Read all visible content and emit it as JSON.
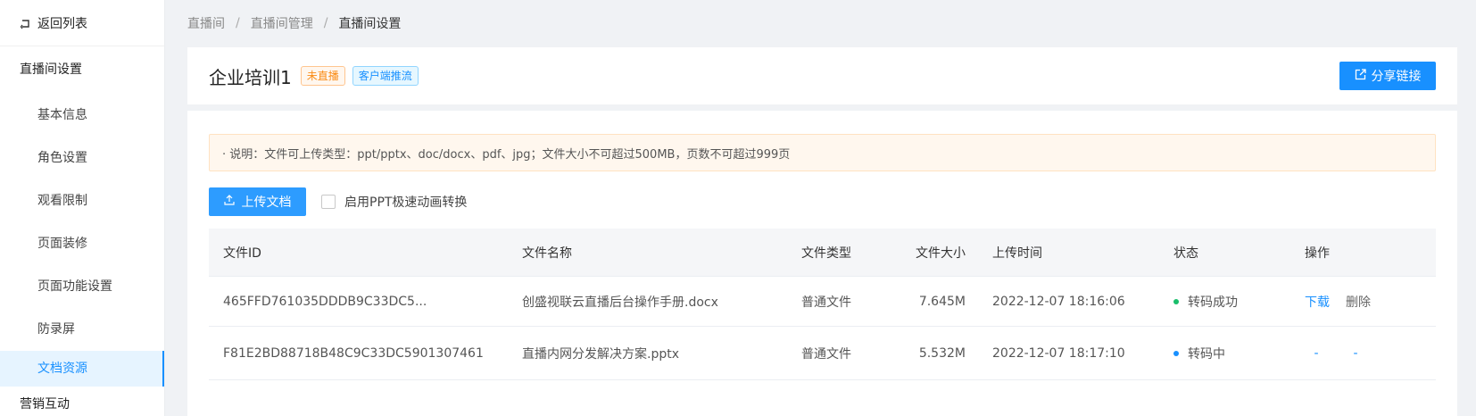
{
  "sidebar": {
    "back_label": "返回列表",
    "group1_title": "直播间设置",
    "items": [
      {
        "label": "基本信息"
      },
      {
        "label": "角色设置"
      },
      {
        "label": "观看限制"
      },
      {
        "label": "页面装修"
      },
      {
        "label": "页面功能设置"
      },
      {
        "label": "防录屏"
      },
      {
        "label": "文档资源",
        "active": true
      }
    ],
    "group2_title": "营销互动"
  },
  "breadcrumb": [
    "直播间",
    "直播间管理",
    "直播间设置"
  ],
  "header": {
    "title": "企业培训1",
    "tags": [
      "未直播",
      "客户端推流"
    ],
    "share_label": "分享链接"
  },
  "notice": "· 说明：文件可上传类型：ppt/pptx、doc/docx、pdf、jpg；文件大小不可超过500MB，页数不可超过999页",
  "upload_label": "上传文档",
  "checkbox_label": "启用PPT极速动画转换",
  "table": {
    "columns": [
      "文件ID",
      "文件名称",
      "文件类型",
      "文件大小",
      "上传时间",
      "状态",
      "操作"
    ],
    "rows": [
      {
        "id": "465FFD761035DDDB9C33DC5...",
        "name": "创盛视联云直播后台操作手册.docx",
        "type": "普通文件",
        "size": "7.645M",
        "time": "2022-12-07 18:16:06",
        "status": "转码成功",
        "status_color": "#19be6b",
        "actions": [
          "下载",
          "删除"
        ]
      },
      {
        "id": "F81E2BD88718B48C9C33DC5901307461",
        "name": "直播内网分发解决方案.pptx",
        "type": "普通文件",
        "size": "5.532M",
        "time": "2022-12-07 18:17:10",
        "status": "转码中",
        "status_color": "#1890ff",
        "actions": [
          "-",
          "-"
        ]
      }
    ]
  },
  "colors": {
    "accent": "#1890ff",
    "success": "#19be6b",
    "warning": "#fa8c16"
  }
}
